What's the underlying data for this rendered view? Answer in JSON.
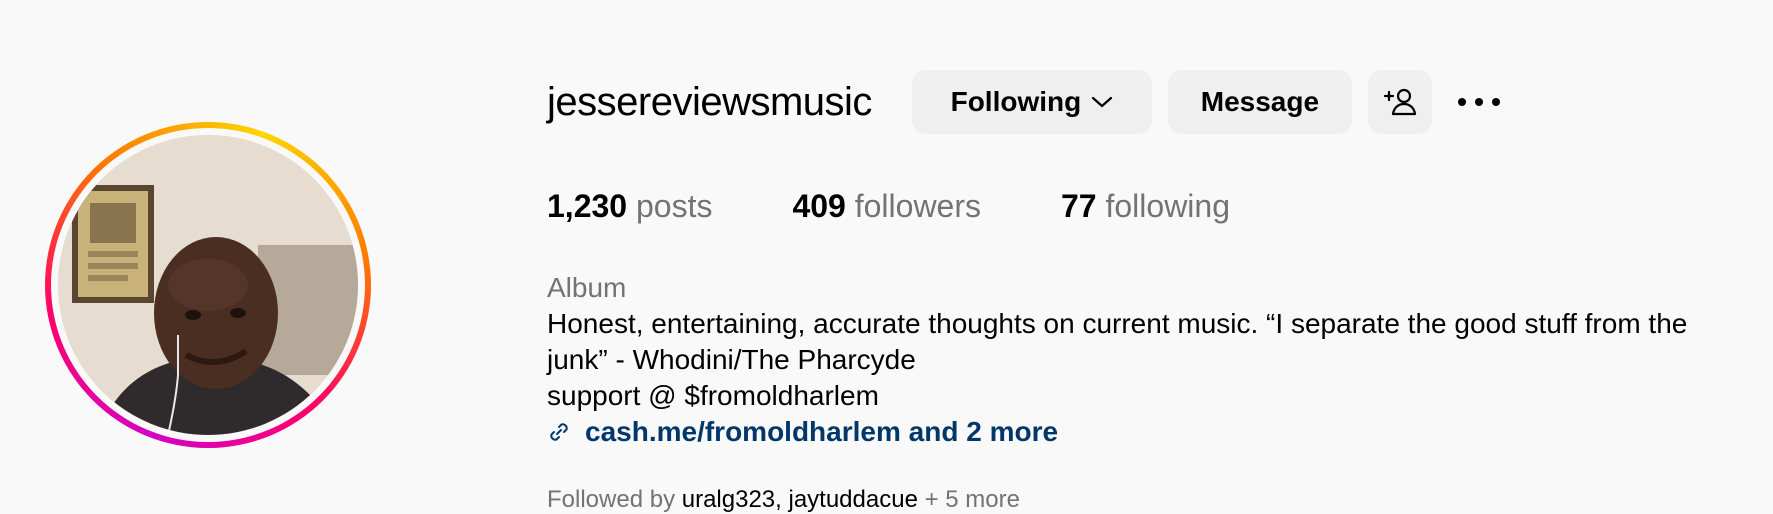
{
  "profile": {
    "username": "jessereviewsmusic",
    "avatar_icon": "profile-photo",
    "ring_colors": [
      "#d300c5",
      "#ff0069",
      "#ff7a00",
      "#ffd600"
    ]
  },
  "actions": {
    "following_label": "Following",
    "message_label": "Message",
    "add_user_icon": "add-user-icon",
    "more_icon": "more-options-icon"
  },
  "stats": {
    "posts_count": "1,230",
    "posts_label": "posts",
    "followers_count": "409",
    "followers_label": "followers",
    "following_count": "77",
    "following_label": "following"
  },
  "bio": {
    "category": "Album",
    "line1": "Honest, entertaining, accurate thoughts on current music. “I separate the good stuff from the",
    "line2": "junk” - Whodini/The Pharcyde",
    "line3": "support @ $fromoldharlem",
    "link_text": "cash.me/fromoldharlem and 2 more",
    "link_color": "#00376b"
  },
  "followed_by": {
    "prefix": "Followed by",
    "names": "uralg323, jaytuddacue",
    "suffix": "+ 5 more"
  }
}
